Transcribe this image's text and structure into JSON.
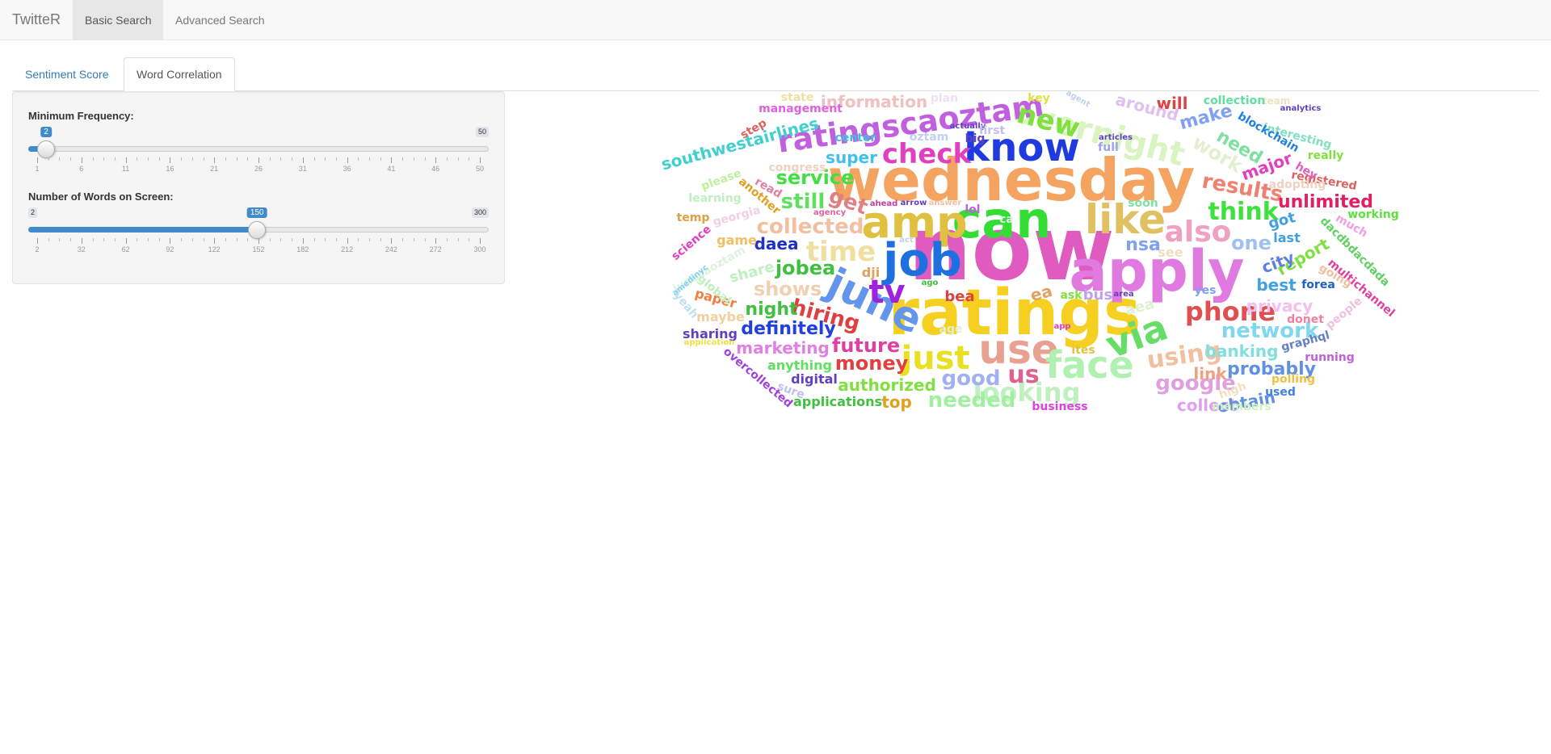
{
  "navbar": {
    "brand": "TwitteR",
    "items": [
      {
        "label": "Basic Search",
        "active": true
      },
      {
        "label": "Advanced Search",
        "active": false
      }
    ]
  },
  "tabs": [
    {
      "label": "Sentiment Score",
      "active": false
    },
    {
      "label": "Word Correlation",
      "active": true
    }
  ],
  "controls": {
    "min_frequency": {
      "label": "Minimum Frequency:",
      "min": "1",
      "max": "50",
      "value": "2",
      "min_badge": "1",
      "max_badge": "50",
      "ticks": [
        "1",
        "6",
        "11",
        "16",
        "21",
        "26",
        "31",
        "36",
        "41",
        "46",
        "50"
      ]
    },
    "num_words": {
      "label": "Number of Words on Screen:",
      "min": "2",
      "max": "300",
      "value": "150",
      "min_badge": "2",
      "max_badge": "300",
      "ticks": [
        "2",
        "32",
        "62",
        "92",
        "122",
        "152",
        "182",
        "212",
        "242",
        "272",
        "300"
      ]
    }
  },
  "wordcloud": {
    "words": [
      {
        "text": "now",
        "color": "#e05bc0"
      },
      {
        "text": "wednesday",
        "color": "#f4a460"
      },
      {
        "text": "ratings",
        "color": "#f5d020"
      },
      {
        "text": "can",
        "color": "#33dd33"
      },
      {
        "text": "apply",
        "color": "#e07ae0"
      },
      {
        "text": "amp",
        "color": "#e0c040"
      },
      {
        "text": "job",
        "color": "#1e6fe0"
      },
      {
        "text": "june",
        "color": "#6495ed"
      },
      {
        "text": "know",
        "color": "#1e3ae0"
      },
      {
        "text": "like",
        "color": "#e0c060"
      },
      {
        "text": "use",
        "color": "#e8a090"
      },
      {
        "text": "face",
        "color": "#b0f0b0"
      },
      {
        "text": "via",
        "color": "#66dd66"
      },
      {
        "text": "overnight",
        "color": "#d8f5c0"
      },
      {
        "text": "ratingscaoztam",
        "color": "#c060e0"
      },
      {
        "text": "check",
        "color": "#e040c0"
      },
      {
        "text": "just",
        "color": "#e8e020"
      },
      {
        "text": "time",
        "color": "#f0e0a0"
      },
      {
        "text": "tv",
        "color": "#a020e0"
      },
      {
        "text": "also",
        "color": "#f0a0c0"
      },
      {
        "text": "phone",
        "color": "#e05050"
      },
      {
        "text": "looking",
        "color": "#c0f0c0"
      },
      {
        "text": "us",
        "color": "#e06090"
      },
      {
        "text": "new",
        "color": "#80e040"
      },
      {
        "text": "think",
        "color": "#40e040"
      },
      {
        "text": "results",
        "color": "#f08070"
      },
      {
        "text": "collected",
        "color": "#f0c0a0"
      },
      {
        "text": "jobea",
        "color": "#40c040"
      },
      {
        "text": "service",
        "color": "#40e040"
      },
      {
        "text": "still",
        "color": "#60e060"
      },
      {
        "text": "get",
        "color": "#e08080"
      },
      {
        "text": "hiring",
        "color": "#e04040"
      },
      {
        "text": "future",
        "color": "#e040a0"
      },
      {
        "text": "money",
        "color": "#e04040"
      },
      {
        "text": "network",
        "color": "#80d8f0"
      },
      {
        "text": "using",
        "color": "#f0c0a0"
      },
      {
        "text": "good",
        "color": "#a0b0f0"
      },
      {
        "text": "needed",
        "color": "#a0f0a0"
      },
      {
        "text": "google",
        "color": "#e0a0e0"
      },
      {
        "text": "probably",
        "color": "#6090e0"
      },
      {
        "text": "unlimited",
        "color": "#e02060"
      },
      {
        "text": "one",
        "color": "#a0c0f0"
      },
      {
        "text": "nsa",
        "color": "#80a0f0"
      },
      {
        "text": "shows",
        "color": "#f0d0b0"
      },
      {
        "text": "definitely",
        "color": "#2040e0"
      },
      {
        "text": "marketing",
        "color": "#e080e0"
      },
      {
        "text": "authorized",
        "color": "#80e040"
      },
      {
        "text": "daea",
        "color": "#2030c0"
      },
      {
        "text": "night",
        "color": "#40c040"
      },
      {
        "text": "work",
        "color": "#e0f0d0"
      },
      {
        "text": "need",
        "color": "#80e0a0"
      },
      {
        "text": "make",
        "color": "#80a0f0"
      },
      {
        "text": "major",
        "color": "#e040c0"
      },
      {
        "text": "information",
        "color": "#f0c0c0"
      },
      {
        "text": "super",
        "color": "#40c0f0"
      },
      {
        "text": "southwestairlines",
        "color": "#40d0d0"
      },
      {
        "text": "will",
        "color": "#e04040"
      },
      {
        "text": "around",
        "color": "#e0c0f0"
      },
      {
        "text": "report",
        "color": "#80e040"
      },
      {
        "text": "city",
        "color": "#6080e0"
      },
      {
        "text": "best",
        "color": "#40a0e0"
      },
      {
        "text": "banking",
        "color": "#80e0e0"
      },
      {
        "text": "link",
        "color": "#f0a080"
      },
      {
        "text": "collect",
        "color": "#e0a0f0"
      },
      {
        "text": "obtain",
        "color": "#6090e0"
      },
      {
        "text": "top",
        "color": "#e0a020"
      },
      {
        "text": "privacy",
        "color": "#f0c0f0"
      },
      {
        "text": "bea",
        "color": "#e04040"
      },
      {
        "text": "ea",
        "color": "#e0a060"
      },
      {
        "text": "bus",
        "color": "#c0a0f0"
      },
      {
        "text": "ask",
        "color": "#80e040"
      },
      {
        "text": "see",
        "color": "#f0e0c0"
      },
      {
        "text": "share",
        "color": "#c0f0c0"
      },
      {
        "text": "game",
        "color": "#f0c060"
      },
      {
        "text": "paper",
        "color": "#f08040"
      },
      {
        "text": "maybe",
        "color": "#f0d0a0"
      },
      {
        "text": "sharing",
        "color": "#6040c0"
      },
      {
        "text": "anything",
        "color": "#60e060"
      },
      {
        "text": "digital",
        "color": "#6040c0"
      },
      {
        "text": "applications",
        "color": "#40c040"
      },
      {
        "text": "overcollected",
        "color": "#a040e0"
      },
      {
        "text": "business",
        "color": "#e040e0"
      },
      {
        "text": "members",
        "color": "#d0f0c0"
      },
      {
        "text": "used",
        "color": "#4080e0"
      },
      {
        "text": "polling",
        "color": "#f0c040"
      },
      {
        "text": "running",
        "color": "#c060e0"
      },
      {
        "text": "graphql",
        "color": "#6080c0"
      },
      {
        "text": "donet",
        "color": "#f080a0"
      },
      {
        "text": "people",
        "color": "#f0c0e0"
      },
      {
        "text": "multichannel",
        "color": "#e040a0"
      },
      {
        "text": "going",
        "color": "#f0c0a0"
      },
      {
        "text": "forea",
        "color": "#2060c0"
      },
      {
        "text": "dacdbdacdada",
        "color": "#60d060"
      },
      {
        "text": "much",
        "color": "#f0a0e0"
      },
      {
        "text": "working",
        "color": "#60e040"
      },
      {
        "text": "registered",
        "color": "#e06060"
      },
      {
        "text": "adopting",
        "color": "#f0d0c0"
      },
      {
        "text": "hey",
        "color": "#e060c0"
      },
      {
        "text": "really",
        "color": "#80e040"
      },
      {
        "text": "interesting",
        "color": "#80e0c0"
      },
      {
        "text": "blockchain",
        "color": "#2080e0"
      },
      {
        "text": "analytics",
        "color": "#6040c0"
      },
      {
        "text": "team",
        "color": "#f0e0c0"
      },
      {
        "text": "collection",
        "color": "#60e0a0"
      },
      {
        "text": "got",
        "color": "#40a0e0"
      },
      {
        "text": "last",
        "color": "#40a0e0"
      },
      {
        "text": "yes",
        "color": "#80a0f0"
      },
      {
        "text": "key",
        "color": "#e0e040"
      },
      {
        "text": "agent",
        "color": "#c0d0f0"
      },
      {
        "text": "management",
        "color": "#e060e0"
      },
      {
        "text": "state",
        "color": "#f0e0a0"
      },
      {
        "text": "plan",
        "color": "#f0e0f0"
      },
      {
        "text": "step",
        "color": "#e06060"
      },
      {
        "text": "center",
        "color": "#40c0e0"
      },
      {
        "text": "actually",
        "color": "#6040c0"
      },
      {
        "text": "first",
        "color": "#c0c0f0"
      },
      {
        "text": "oztam",
        "color": "#c0d0f0"
      },
      {
        "text": "big",
        "color": "#6040c0"
      },
      {
        "text": "full",
        "color": "#a0a0f0"
      },
      {
        "text": "articles",
        "color": "#6040c0"
      },
      {
        "text": "soon",
        "color": "#80e0a0"
      },
      {
        "text": "lol",
        "color": "#c060e0"
      },
      {
        "text": "ca",
        "color": "#e0f0f0"
      },
      {
        "text": "congress",
        "color": "#f0d0c0"
      },
      {
        "text": "please",
        "color": "#c0f0a0"
      },
      {
        "text": "read",
        "color": "#e080a0"
      },
      {
        "text": "another",
        "color": "#e0a020"
      },
      {
        "text": "learning",
        "color": "#c0f0c0"
      },
      {
        "text": "temp",
        "color": "#e0a040"
      },
      {
        "text": "georgia",
        "color": "#f0d0e0"
      },
      {
        "text": "agency",
        "color": "#e060a0"
      },
      {
        "text": "science",
        "color": "#e040c0"
      },
      {
        "text": "junecaoztam",
        "color": "#e0f0e0"
      },
      {
        "text": "amedinyc",
        "color": "#80d0f0"
      },
      {
        "text": "global",
        "color": "#c0f0c0"
      },
      {
        "text": "yeah",
        "color": "#c0e0f0"
      },
      {
        "text": "application",
        "color": "#f0e040"
      },
      {
        "text": "dji",
        "color": "#e0a060"
      },
      {
        "text": "ahead",
        "color": "#c040a0"
      },
      {
        "text": "arrow",
        "color": "#6040c0"
      },
      {
        "text": "answer",
        "color": "#f0c0a0"
      },
      {
        "text": "act",
        "color": "#c0d0f0"
      },
      {
        "text": "ago",
        "color": "#40c040"
      },
      {
        "text": "area",
        "color": "#6040c0"
      },
      {
        "text": "aea",
        "color": "#e0f0d0"
      },
      {
        "text": "ites",
        "color": "#e0c040"
      },
      {
        "text": "age",
        "color": "#e0f0d0"
      },
      {
        "text": "app",
        "color": "#e040c0"
      },
      {
        "text": "sure",
        "color": "#c0c0f0"
      },
      {
        "text": "high",
        "color": "#f0e0c0"
      }
    ]
  }
}
